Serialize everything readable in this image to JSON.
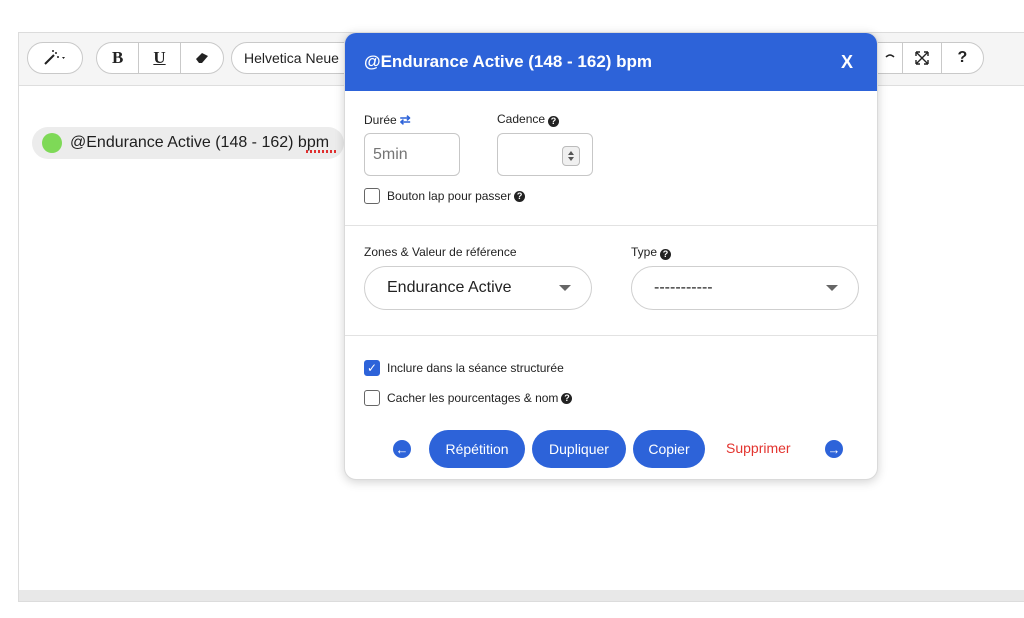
{
  "toolbar": {
    "magic_icon": "magic-wand-icon",
    "bold_label": "B",
    "underline_label": "U",
    "eraser_icon": "eraser-icon",
    "font_select": "Helvetica Neue",
    "fullscreen_icon": "expand-icon",
    "help_label": "?"
  },
  "editor": {
    "chip_label": "@Endurance Active (148 - 162) bpm"
  },
  "popup": {
    "title": "@Endurance Active (148 - 162) bpm",
    "close_label": "X",
    "duration": {
      "label": "Durée",
      "value_placeholder": "5min"
    },
    "cadence": {
      "label": "Cadence",
      "value": ""
    },
    "lap_checkbox": {
      "label": "Bouton lap pour passer",
      "checked": false
    },
    "zones": {
      "label": "Zones & Valeur de référence",
      "selected": "Endurance Active"
    },
    "type": {
      "label": "Type",
      "selected": "-----------"
    },
    "include_checkbox": {
      "label": "Inclure dans la séance structurée",
      "checked": true
    },
    "hide_checkbox": {
      "label": "Cacher les pourcentages & nom",
      "checked": false
    },
    "actions": {
      "repeat": "Répétition",
      "duplicate": "Dupliquer",
      "copy": "Copier",
      "delete": "Supprimer"
    }
  },
  "colors": {
    "accent": "#2d63d9",
    "danger": "#e3342f",
    "zone_dot": "#7ed957"
  }
}
